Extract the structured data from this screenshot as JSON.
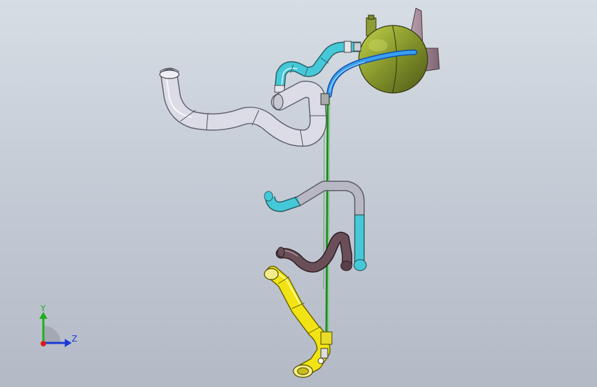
{
  "viewport": {
    "background_top": "#d7dde4",
    "background_bottom": "#b3bac6"
  },
  "parts": [
    {
      "name": "expansion-tank",
      "color": "#7e8e28"
    },
    {
      "name": "tank-bracket",
      "color": "#9a7f8a"
    },
    {
      "name": "overflow-hose",
      "color": "#2f8fe8"
    },
    {
      "name": "upper-cyan-hose",
      "color": "#45c8d8"
    },
    {
      "name": "silver-radiator-hose",
      "color": "#d4d4de"
    },
    {
      "name": "mid-cyan-gray-hose",
      "color": "#45c8d8"
    },
    {
      "name": "dark-brown-hose",
      "color": "#5a4048"
    },
    {
      "name": "yellow-hose",
      "color": "#f0e010"
    },
    {
      "name": "green-wire",
      "color": "#25a025"
    }
  ],
  "triad": {
    "y_label": "Y",
    "z_label": "Z",
    "y_color": "#1cb01c",
    "z_color": "#1a3ad8",
    "x_color": "#d81c1c"
  }
}
